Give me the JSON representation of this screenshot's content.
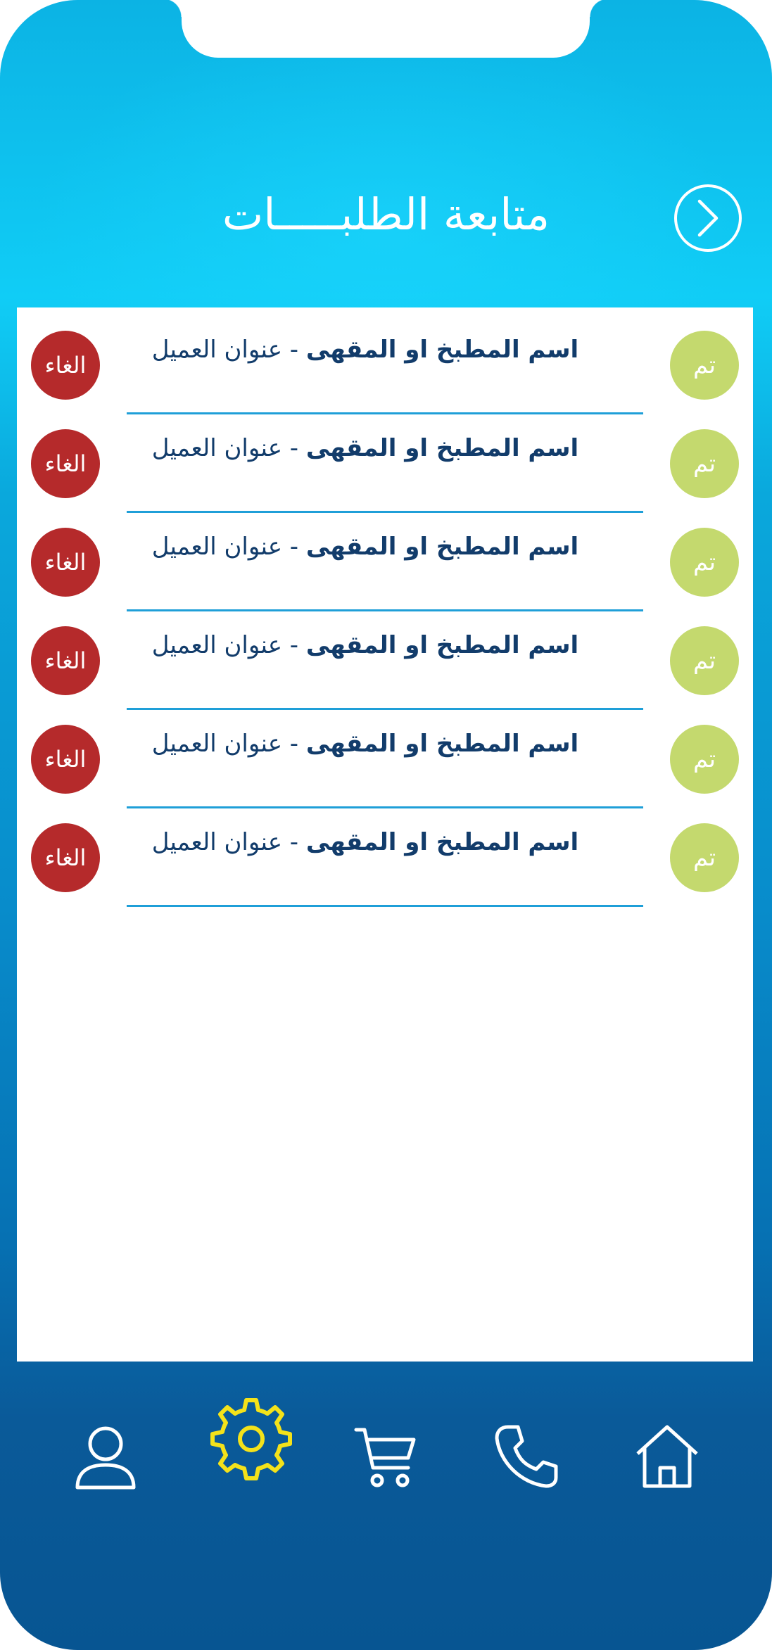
{
  "header": {
    "title": "متابعة الطلبـــــات",
    "back_icon": "chevron-right-icon"
  },
  "orders": [
    {
      "done_label": "تم",
      "name": "اسم المطبخ او المقهى",
      "separator": " - ",
      "address": "عنوان العميل",
      "cancel_label": "الغاء"
    },
    {
      "done_label": "تم",
      "name": "اسم المطبخ او المقهى",
      "separator": " - ",
      "address": "عنوان العميل",
      "cancel_label": "الغاء"
    },
    {
      "done_label": "تم",
      "name": "اسم المطبخ او المقهى",
      "separator": " - ",
      "address": "عنوان العميل",
      "cancel_label": "الغاء"
    },
    {
      "done_label": "تم",
      "name": "اسم المطبخ او المقهى",
      "separator": " - ",
      "address": "عنوان العميل",
      "cancel_label": "الغاء"
    },
    {
      "done_label": "تم",
      "name": "اسم المطبخ او المقهى",
      "separator": " - ",
      "address": "عنوان العميل",
      "cancel_label": "الغاء"
    },
    {
      "done_label": "تم",
      "name": "اسم المطبخ او المقهى",
      "separator": " - ",
      "address": "عنوان العميل",
      "cancel_label": "الغاء"
    }
  ],
  "bottom_nav": {
    "items": [
      "profile-icon",
      "settings-icon",
      "cart-icon",
      "phone-icon",
      "home-icon"
    ],
    "active": "settings-icon"
  },
  "colors": {
    "cancel": "#b52a2b",
    "done": "#c4d96e",
    "text": "#123c6b",
    "divider": "#1f9fd8",
    "active_icon": "#f4e21a"
  }
}
